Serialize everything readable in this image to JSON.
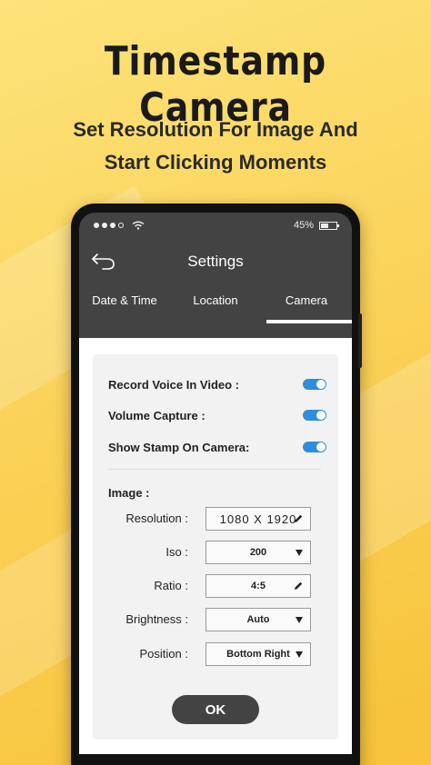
{
  "promo": {
    "headline": "Timestamp Camera",
    "tagline_line1": "Set Resolution For Image And",
    "tagline_line2": "Start Clicking Moments"
  },
  "status_bar": {
    "battery": "45%",
    "battery_level": 0.45
  },
  "app_bar": {
    "title": "Settings",
    "back_icon": "back-arrow-icon"
  },
  "tabs": [
    {
      "label": "Date & Time",
      "active": false
    },
    {
      "label": "Location",
      "active": false
    },
    {
      "label": "Camera",
      "active": true
    }
  ],
  "toggles": [
    {
      "label": "Record Voice In Video :",
      "on": true
    },
    {
      "label": "Volume Capture :",
      "on": true
    },
    {
      "label": "Show Stamp On Camera:",
      "on": true
    }
  ],
  "image_section": {
    "label": "Image :",
    "fields": [
      {
        "label": "Resolution :",
        "value": "1080 X 1920",
        "control": "edit"
      },
      {
        "label": "Iso :",
        "value": "200",
        "control": "dropdown"
      },
      {
        "label": "Ratio :",
        "value": "4:5",
        "control": "edit"
      },
      {
        "label": "Brightness :",
        "value": "Auto",
        "control": "dropdown"
      },
      {
        "label": "Position :",
        "value": "Bottom Right",
        "control": "dropdown"
      }
    ]
  },
  "actions": {
    "ok_label": "OK"
  },
  "colors": {
    "accent_blue": "#2d8ee0",
    "app_bar": "#434343",
    "background_yellow": "#fbd35a"
  }
}
